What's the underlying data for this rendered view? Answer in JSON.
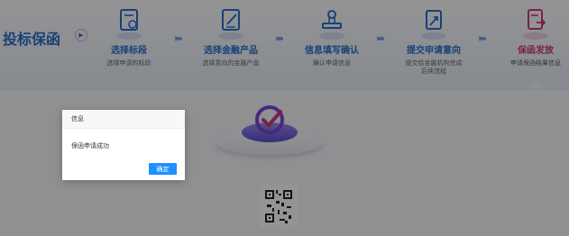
{
  "brand": {
    "title": "投标保函"
  },
  "steps": [
    {
      "title": "选择标段",
      "desc": "选择申请的标段",
      "icon": "certificate-icon"
    },
    {
      "title": "选择金融产品",
      "desc": "选择意向的金融产品",
      "icon": "edit-document-icon"
    },
    {
      "title": "信息填写确认",
      "desc": "确认申请信息",
      "icon": "stamp-icon"
    },
    {
      "title": "提交申请意向",
      "desc": "提交给金融机构完成后续流程",
      "desc_line1": "提交给金融机构完成",
      "desc_line2": "后续流程",
      "icon": "submit-document-icon"
    },
    {
      "title": "保函发放",
      "desc": "申请保函结果信息",
      "icon": "export-document-icon",
      "active": true
    }
  ],
  "colors": {
    "accent_blue": "#2d6fd1",
    "active_pink": "#d2387e",
    "confirm_button": "#1e90ff"
  },
  "dialog": {
    "title": "信息",
    "message": "保函申请成功",
    "confirm_label": "确定"
  }
}
